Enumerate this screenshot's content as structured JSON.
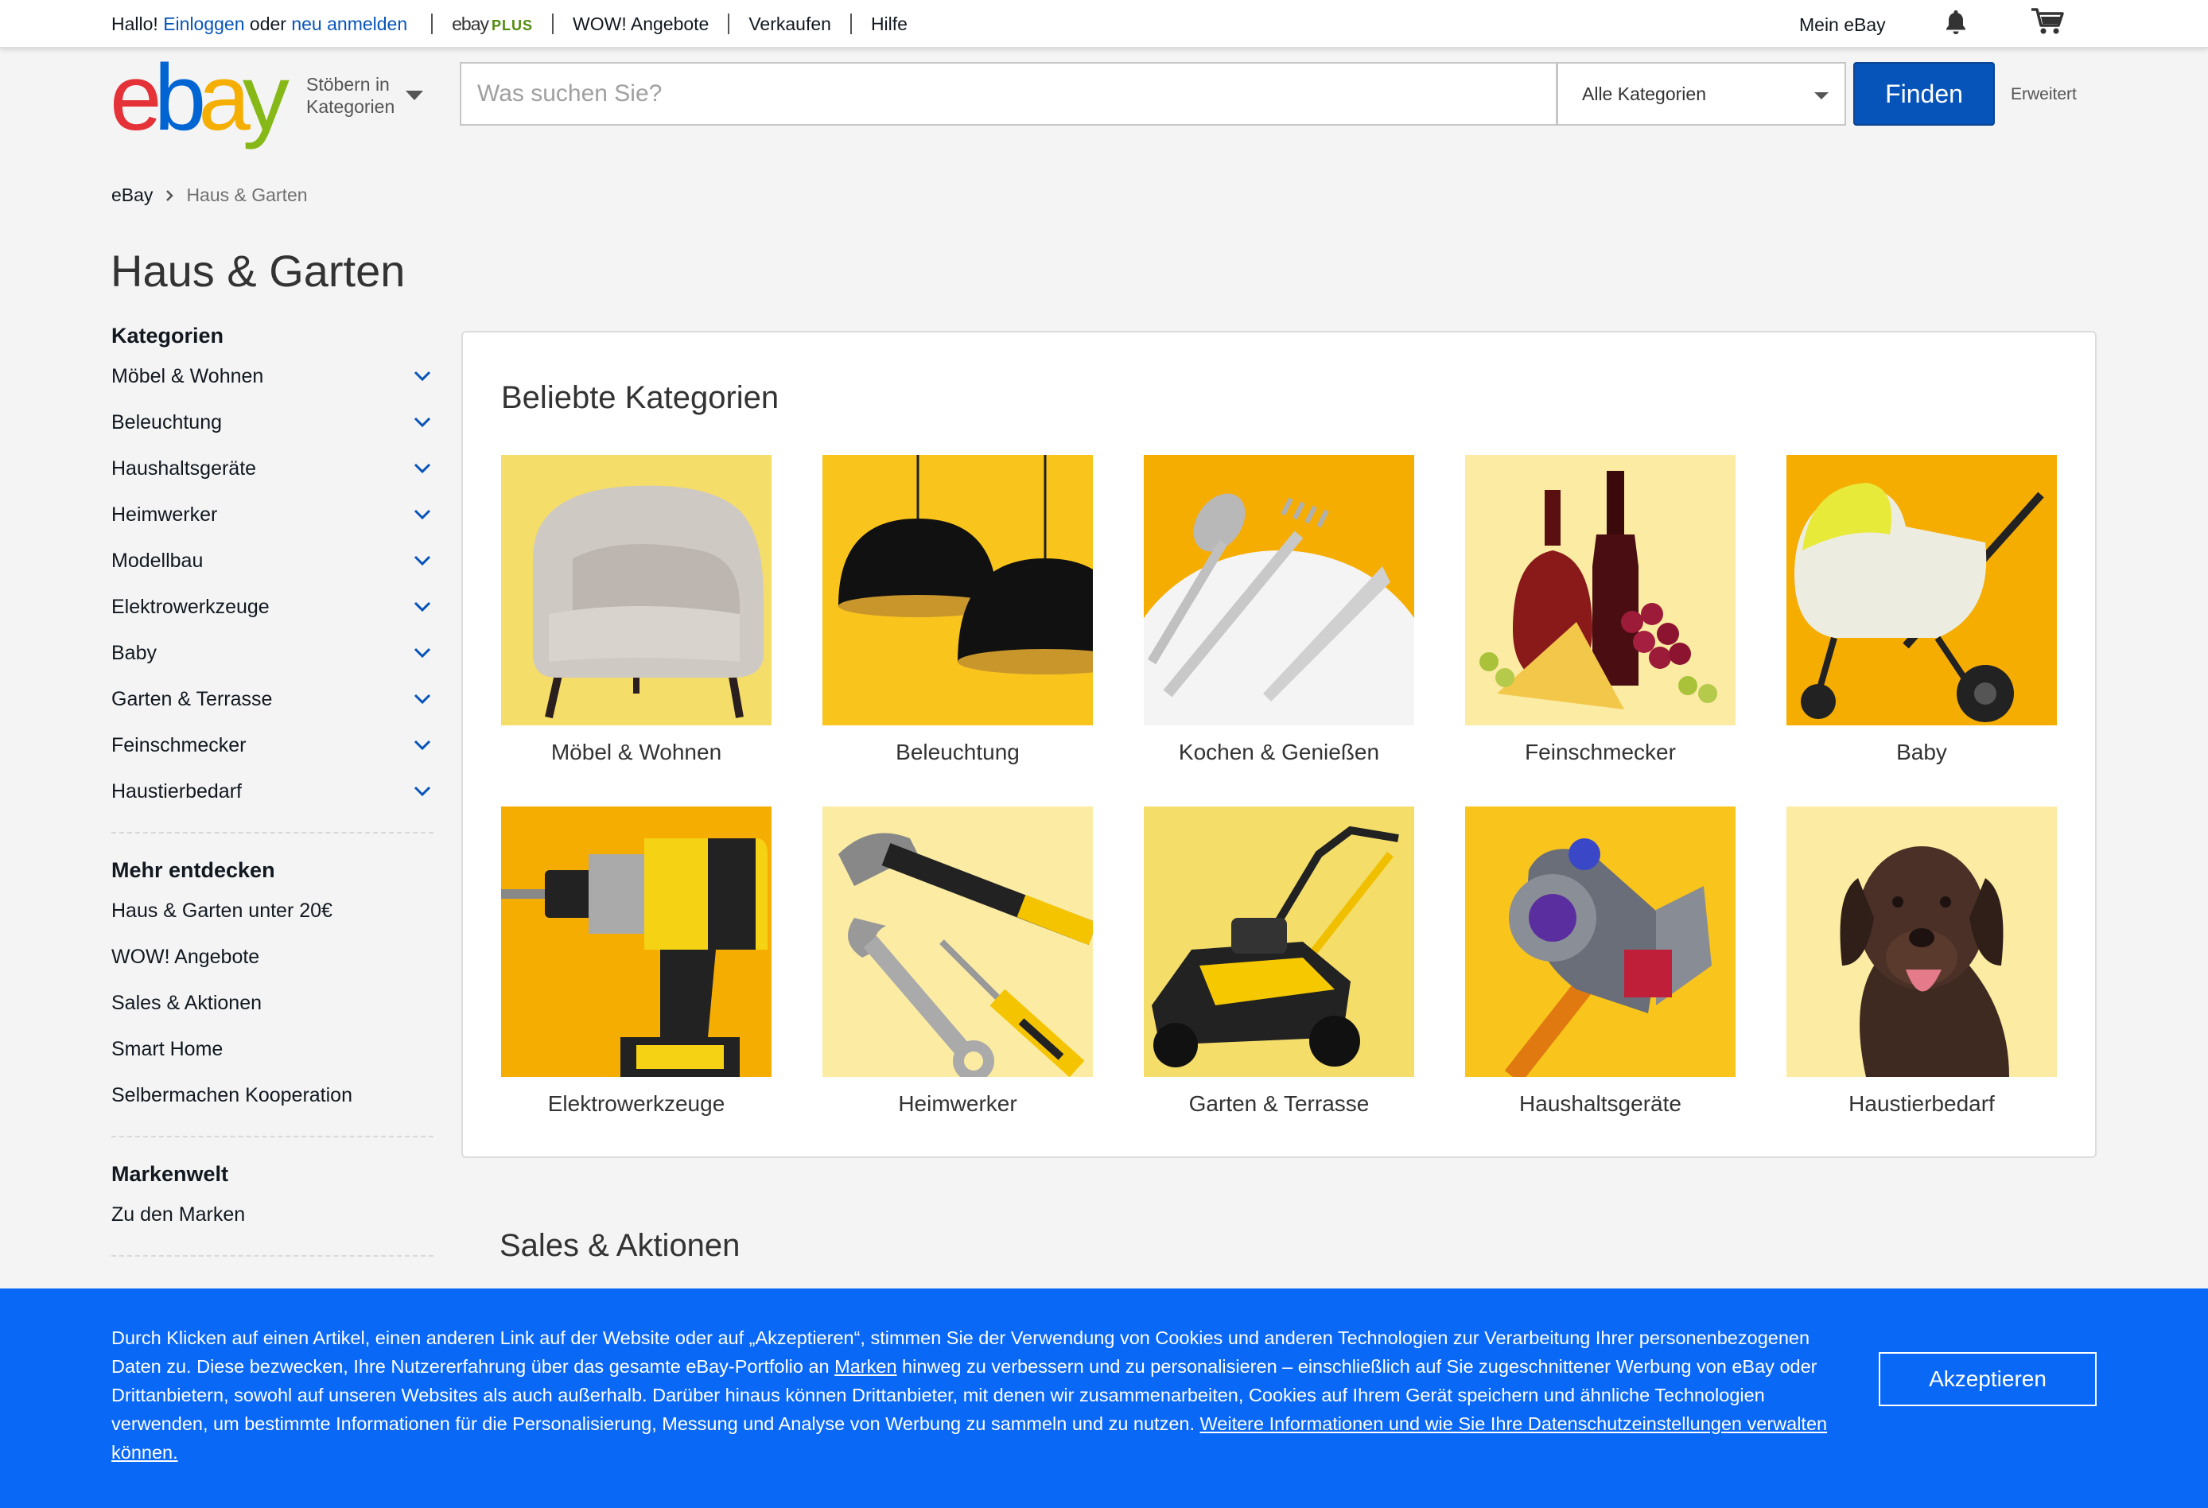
{
  "topbar": {
    "greeting": "Hallo!",
    "login": "Einloggen",
    "or": "oder",
    "register": "neu anmelden",
    "ebay_plus_ebay": "ebay",
    "ebay_plus_plus": "PLUS",
    "wow": "WOW! Angebote",
    "sell": "Verkaufen",
    "help": "Hilfe",
    "my_ebay": "Mein eBay"
  },
  "header": {
    "logo": [
      "e",
      "b",
      "a",
      "y"
    ],
    "browse_line1": "Stöbern in",
    "browse_line2": "Kategorien",
    "search_placeholder": "Was suchen Sie?",
    "category_select": "Alle Kategorien",
    "search_button": "Finden",
    "advanced": "Erweitert"
  },
  "breadcrumb": {
    "root": "eBay",
    "current": "Haus & Garten"
  },
  "page_title": "Haus & Garten",
  "sidebar": {
    "categories_heading": "Kategorien",
    "categories": [
      "Möbel & Wohnen",
      "Beleuchtung",
      "Haushaltsgeräte",
      "Heimwerker",
      "Modellbau",
      "Elektrowerkzeuge",
      "Baby",
      "Garten & Terrasse",
      "Feinschmecker",
      "Haustierbedarf"
    ],
    "discover_heading": "Mehr entdecken",
    "discover": [
      "Haus & Garten unter 20€",
      "WOW! Angebote",
      "Sales & Aktionen",
      "Smart Home",
      "Selbermachen Kooperation"
    ],
    "brands_heading": "Markenwelt",
    "brands": [
      "Zu den Marken"
    ]
  },
  "popular": {
    "title": "Beliebte Kategorien",
    "tiles": [
      {
        "label": "Möbel & Wohnen",
        "icon": "armchair-image",
        "bg": "#f5dd6a"
      },
      {
        "label": "Beleuchtung",
        "icon": "pendant-lamp-image",
        "bg": "#f9c51d"
      },
      {
        "label": "Kochen & Genießen",
        "icon": "cutlery-image",
        "bg": "#f6ad02"
      },
      {
        "label": "Feinschmecker",
        "icon": "wine-cheese-image",
        "bg": "#fbeba3"
      },
      {
        "label": "Baby",
        "icon": "stroller-image",
        "bg": "#f6ad02"
      },
      {
        "label": "Elektrowerkzeuge",
        "icon": "drill-image",
        "bg": "#f6ad02"
      },
      {
        "label": "Heimwerker",
        "icon": "tools-image",
        "bg": "#fbeba3"
      },
      {
        "label": "Garten & Terrasse",
        "icon": "lawnmower-image",
        "bg": "#f5dd6a"
      },
      {
        "label": "Haushaltsgeräte",
        "icon": "vacuum-image",
        "bg": "#f9c51d"
      },
      {
        "label": "Haustierbedarf",
        "icon": "dog-image",
        "bg": "#fbeba3"
      }
    ]
  },
  "sales_title": "Sales & Aktionen",
  "cookie": {
    "text_part1": "Durch Klicken auf einen Artikel, einen anderen Link auf der Website oder auf „Akzeptieren“, stimmen Sie der Verwendung von Cookies und anderen Technologien zur Verarbeitung Ihrer personenbezogenen Daten zu. Diese bezwecken, Ihre Nutzererfahrung über das gesamte eBay-Portfolio an ",
    "link_brands": "Marken",
    "text_part2": " hinweg zu verbessern und zu personalisieren – einschließlich auf Sie zugeschnittener Werbung von eBay oder Drittanbietern, sowohl auf unseren Websites als auch außerhalb. Darüber hinaus können Drittanbieter, mit denen wir zusammenarbeiten, Cookies auf Ihrem Gerät speichern und ähnliche Technologien verwenden, um bestimmte Informationen für die Personalisierung, Messung und Analyse von Werbung zu sammeln und zu nutzen. ",
    "link_more": "Weitere Informationen und wie Sie Ihre Datenschutzeinstellungen verwalten können.",
    "accept": "Akzeptieren"
  },
  "colors": {
    "link_blue": "#0654ba",
    "button_blue": "#0654ba",
    "banner_blue": "#0968f6"
  }
}
